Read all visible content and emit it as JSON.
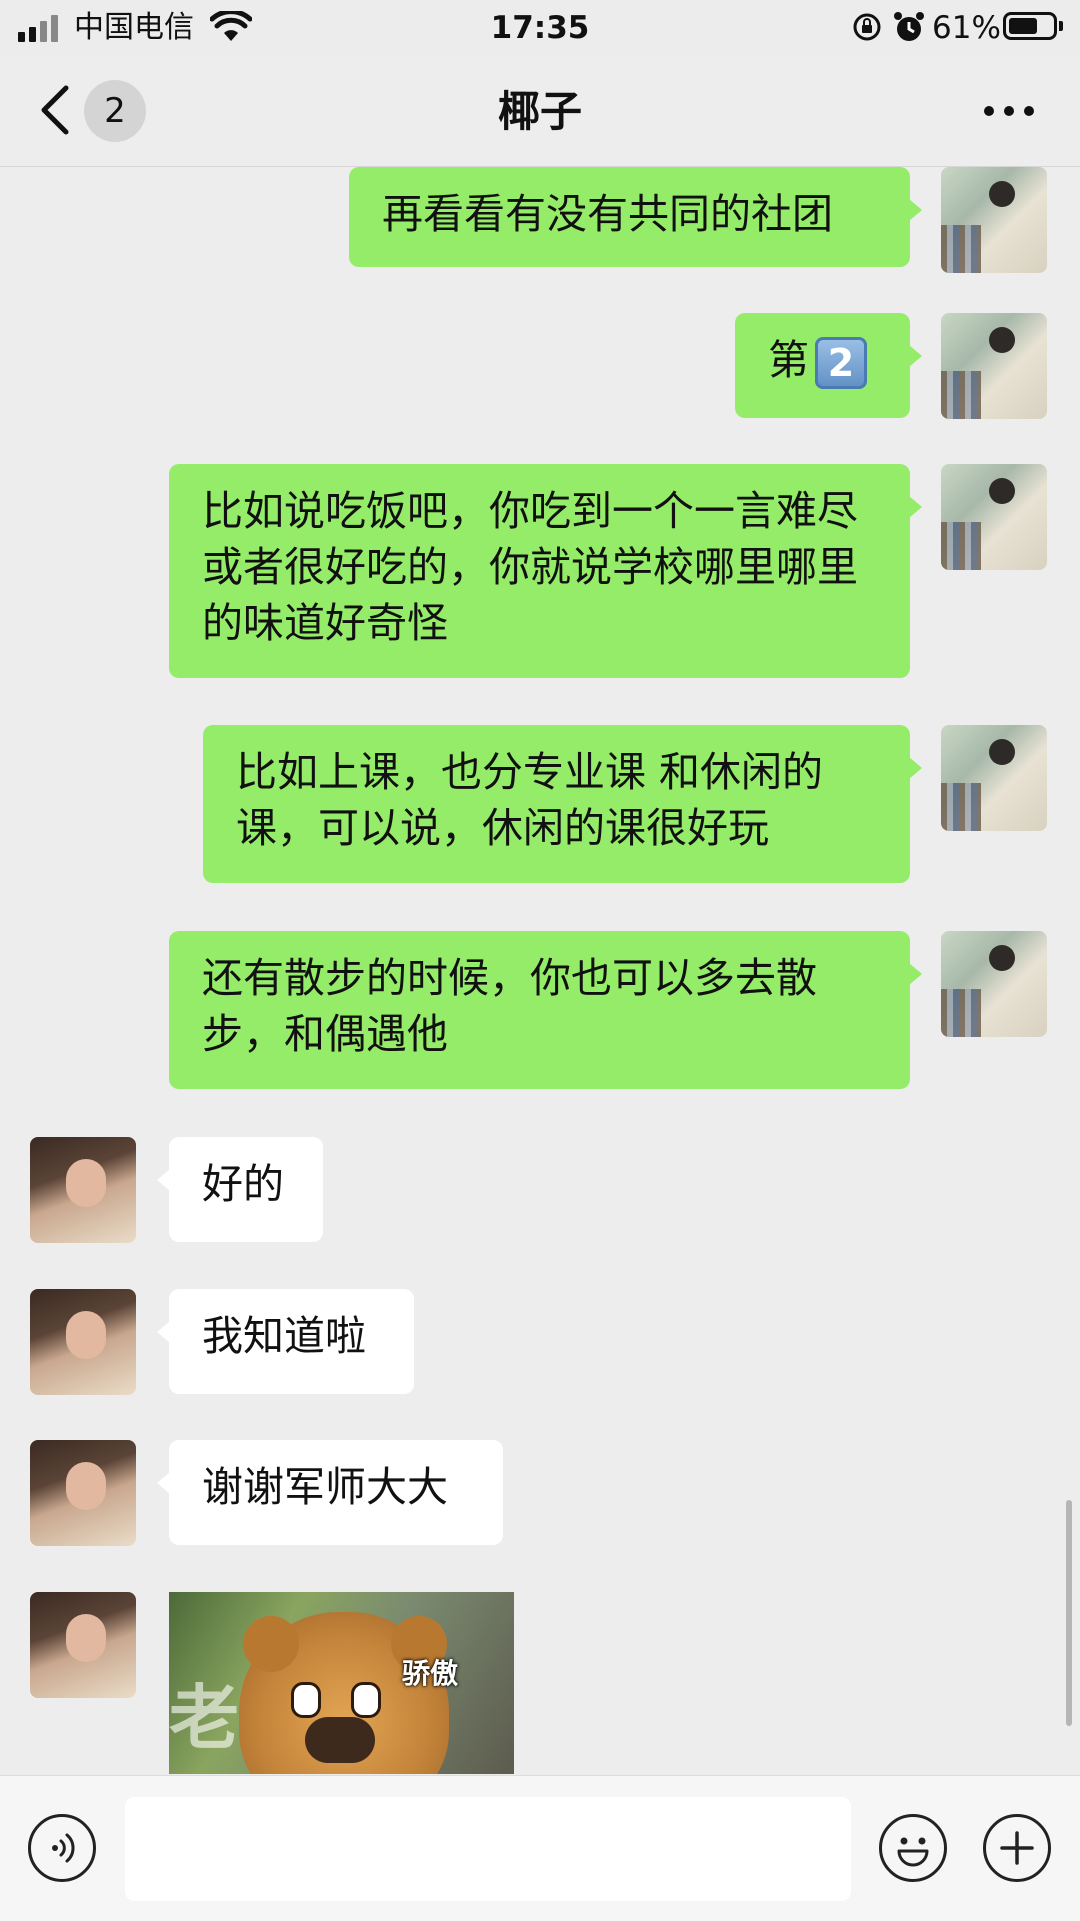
{
  "status_bar": {
    "carrier": "中国电信",
    "time": "17:35",
    "battery": "61%",
    "icons": [
      "signal-icon",
      "wifi-icon",
      "rotation-lock-icon",
      "alarm-icon",
      "battery-icon"
    ]
  },
  "nav": {
    "unread_count": "2",
    "title": "椰子",
    "icons": [
      "back-icon",
      "more-icon"
    ]
  },
  "messages": [
    {
      "from": "me",
      "text": "再看看有没有共同的社团"
    },
    {
      "from": "me",
      "text": "第",
      "emoji": "2"
    },
    {
      "from": "me",
      "text": "比如说吃饭吧，你吃到一个一言难尽或者很好吃的，你就说学校哪里哪里的味道好奇怪"
    },
    {
      "from": "me",
      "text": "比如上课，也分专业课 和休闲的课，可以说，休闲的课很好玩"
    },
    {
      "from": "me",
      "text": "还有散步的时候，你也可以多去散步，和偶遇他"
    },
    {
      "from": "her",
      "text": "好的"
    },
    {
      "from": "her",
      "text": "我知道啦"
    },
    {
      "from": "her",
      "text": "谢谢军师大大"
    },
    {
      "from": "her",
      "type": "sticker",
      "caption": "骄傲",
      "bg_text": "老"
    }
  ],
  "input_bar": {
    "placeholder": "",
    "icons": [
      "voice-icon",
      "emoji-icon",
      "plus-icon"
    ]
  },
  "colors": {
    "my_bubble": "#95ec69",
    "her_bubble": "#ffffff",
    "background": "#ededed"
  }
}
